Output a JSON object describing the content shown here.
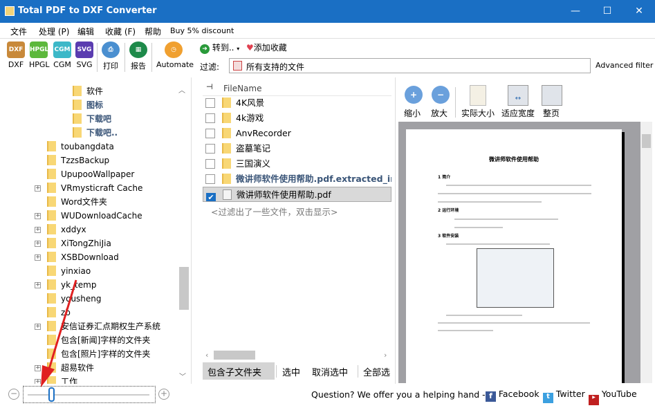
{
  "window": {
    "title": "Total PDF to DXF Converter",
    "minimize": "—",
    "maximize": "☐",
    "close": "✕"
  },
  "menu": [
    "文件",
    "处理 (P)",
    "编辑",
    "收藏 (F)",
    "帮助",
    "Buy 5% discount"
  ],
  "toolbar": {
    "formats": [
      {
        "label": "DXF",
        "color": "#c8893a"
      },
      {
        "label": "HPGL",
        "color": "#5cb83c"
      },
      {
        "label": "CGM",
        "color": "#3cb8c8"
      },
      {
        "label": "SVG",
        "color": "#5a3cb0"
      }
    ],
    "print": "打印",
    "report": "报告",
    "automate": "Automate",
    "goto": "转到..",
    "favorite": "添加收藏",
    "filter_label": "过滤:",
    "filter_value": "所有支持的文件",
    "advanced_filter": "Advanced filter"
  },
  "tree": [
    {
      "label": "软件",
      "level": 2,
      "bold": false,
      "expand": false
    },
    {
      "label": "图标",
      "level": 2,
      "bold": true,
      "expand": false
    },
    {
      "label": "下载吧",
      "level": 2,
      "bold": true,
      "expand": false
    },
    {
      "label": "下载吧..",
      "level": 2,
      "bold": true,
      "expand": false
    },
    {
      "label": "toubangdata",
      "level": 1,
      "bold": false,
      "expand": false
    },
    {
      "label": "TzzsBackup",
      "level": 1,
      "bold": false,
      "expand": false
    },
    {
      "label": "UpupooWallpaper",
      "level": 1,
      "bold": false,
      "expand": false
    },
    {
      "label": "VRmysticraft Cache",
      "level": 1,
      "bold": false,
      "expand": true
    },
    {
      "label": "Word文件夹",
      "level": 1,
      "bold": false,
      "expand": false
    },
    {
      "label": "WUDownloadCache",
      "level": 1,
      "bold": false,
      "expand": true
    },
    {
      "label": "xddyx",
      "level": 1,
      "bold": false,
      "expand": true
    },
    {
      "label": "XiTongZhiJia",
      "level": 1,
      "bold": false,
      "expand": true
    },
    {
      "label": "XSBDownload",
      "level": 1,
      "bold": false,
      "expand": true
    },
    {
      "label": "yinxiao",
      "level": 1,
      "bold": false,
      "expand": false
    },
    {
      "label": "yk_temp",
      "level": 1,
      "bold": false,
      "expand": true
    },
    {
      "label": "yousheng",
      "level": 1,
      "bold": false,
      "expand": false
    },
    {
      "label": "zb",
      "level": 1,
      "bold": false,
      "expand": false
    },
    {
      "label": "安信证券汇点期权生产系统",
      "level": 1,
      "bold": false,
      "expand": true
    },
    {
      "label": "包含[新闻]字样的文件夹",
      "level": 1,
      "bold": false,
      "expand": false
    },
    {
      "label": "包含[照片]字样的文件夹",
      "level": 1,
      "bold": false,
      "expand": false
    },
    {
      "label": "超易软件",
      "level": 1,
      "bold": false,
      "expand": true
    },
    {
      "label": "工作",
      "level": 1,
      "bold": false,
      "expand": true
    }
  ],
  "files": {
    "header": "FileName",
    "items": [
      {
        "name": "4K风景",
        "type": "folder",
        "checked": false,
        "bold": false
      },
      {
        "name": "4k游戏",
        "type": "folder",
        "checked": false,
        "bold": false
      },
      {
        "name": "AnvRecorder",
        "type": "folder",
        "checked": false,
        "bold": false
      },
      {
        "name": "盗墓笔记",
        "type": "folder",
        "checked": false,
        "bold": false
      },
      {
        "name": "三国演义",
        "type": "folder",
        "checked": false,
        "bold": false
      },
      {
        "name": "微讲师软件使用帮助.pdf.extracted_images",
        "type": "folder",
        "checked": false,
        "bold": true
      },
      {
        "name": "微讲师软件使用帮助.pdf",
        "type": "pdf",
        "checked": true,
        "bold": false
      }
    ],
    "filtered_note": "<过滤出了一些文件，双击显示>"
  },
  "bottom_buttons": [
    "包含子文件夹",
    "选中",
    "取消选中",
    "全部选"
  ],
  "preview": {
    "tools": [
      "缩小",
      "放大",
      "实际大小",
      "适应宽度",
      "整页"
    ],
    "doc_title": "微讲师软件使用帮助",
    "sections": [
      "1  简介",
      "2  运行环境",
      "3  软件安装"
    ]
  },
  "status": {
    "question": "Question? We offer you a helping hand -",
    "facebook": "Facebook",
    "twitter": "Twitter",
    "youtube": "YouTube"
  },
  "zoom_slider": {
    "value": 0.17
  }
}
